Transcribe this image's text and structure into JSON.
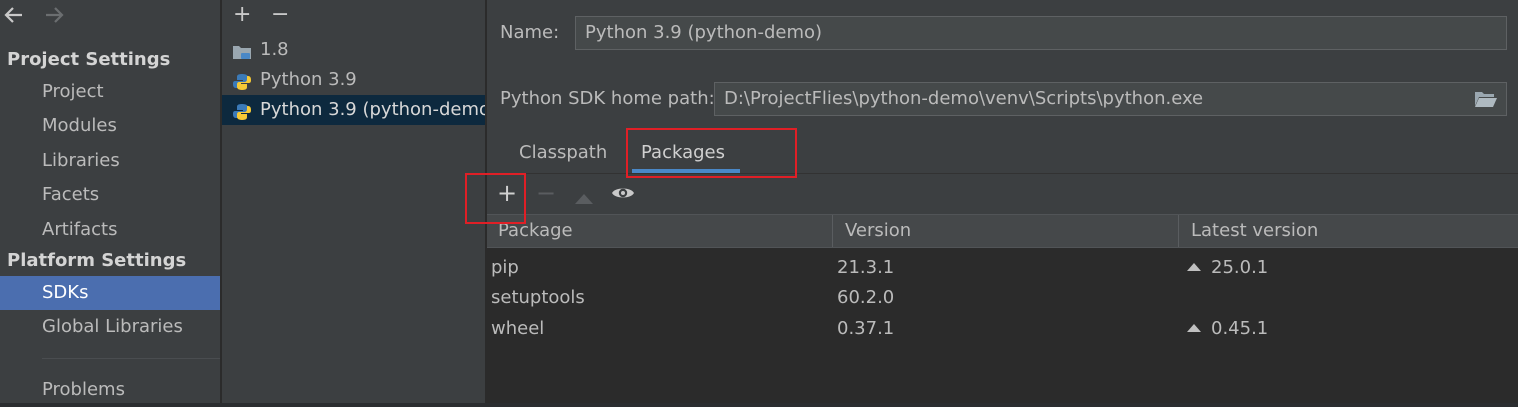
{
  "nav": {
    "back_icon": "back-arrow-icon",
    "forward_icon": "forward-arrow-icon"
  },
  "sidebar": {
    "project_settings_title": "Project Settings",
    "project_items": [
      {
        "label": "Project"
      },
      {
        "label": "Modules"
      },
      {
        "label": "Libraries"
      },
      {
        "label": "Facets"
      },
      {
        "label": "Artifacts"
      }
    ],
    "platform_settings_title": "Platform Settings",
    "platform_items": [
      {
        "label": "SDKs",
        "selected": true
      },
      {
        "label": "Global Libraries"
      }
    ],
    "problems_label": "Problems"
  },
  "sdk_list": {
    "add_label": "+",
    "remove_label": "−",
    "items": [
      {
        "label": "1.8",
        "icon": "folder-jdk-icon"
      },
      {
        "label": "Python 3.9",
        "icon": "python-icon"
      },
      {
        "label": "Python 3.9 (python-demo)",
        "icon": "python-icon",
        "selected": true
      }
    ]
  },
  "detail": {
    "name_label": "Name:",
    "name_value": "Python 3.9 (python-demo)",
    "home_path_label": "Python SDK home path:",
    "home_path_value": "D:\\ProjectFlies\\python-demo\\venv\\Scripts\\python.exe",
    "browse_icon": "folder-open-icon",
    "tabs": [
      {
        "label": "Classpath"
      },
      {
        "label": "Packages",
        "selected": true
      }
    ],
    "toolbar": {
      "install_label": "+",
      "uninstall_label": "−",
      "upgrade_icon": "triangle-up-icon",
      "show_early_releases_icon": "eye-icon"
    },
    "table": {
      "headers": [
        "Package",
        "Version",
        "Latest version"
      ],
      "rows": [
        {
          "package": "pip",
          "version": "21.3.1",
          "latest": "25.0.1",
          "has_update": true
        },
        {
          "package": "setuptools",
          "version": "60.2.0",
          "latest": "",
          "has_update": false
        },
        {
          "package": "wheel",
          "version": "0.37.1",
          "latest": "0.45.1",
          "has_update": true
        }
      ]
    }
  },
  "colors": {
    "background": "#3c3f41",
    "selection": "#4b6eaf",
    "list_selection": "#0d293e",
    "tab_underline": "#4a88c7",
    "highlight": "#e01f26"
  }
}
